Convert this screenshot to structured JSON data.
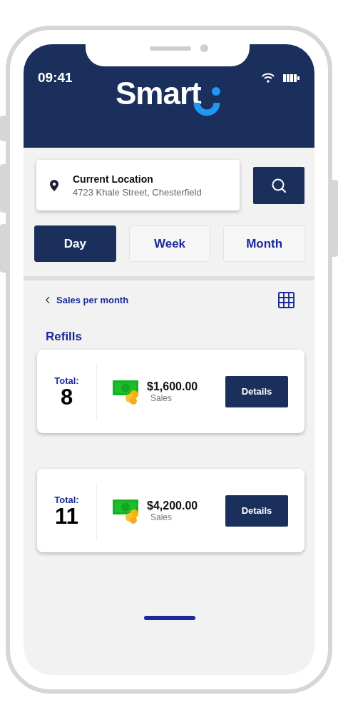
{
  "status_bar": {
    "time": "09:41"
  },
  "header": {
    "logo": "Smart"
  },
  "location": {
    "label": "Current Location",
    "address": "4723 Khale Street, Chesterfield"
  },
  "tabs": [
    {
      "label": "Day",
      "selected": true
    },
    {
      "label": "Week",
      "selected": false
    },
    {
      "label": "Month",
      "selected": false
    }
  ],
  "nav": {
    "back_label": "Sales per month"
  },
  "section_title": "Refills",
  "cards": [
    {
      "total_label": "Total:",
      "total": "8",
      "amount": "$1,600.00",
      "amount_label": "Sales",
      "button": "Details"
    },
    {
      "total_label": "Total:",
      "total": "11",
      "amount": "$4,200.00",
      "amount_label": "Sales",
      "button": "Details"
    }
  ]
}
